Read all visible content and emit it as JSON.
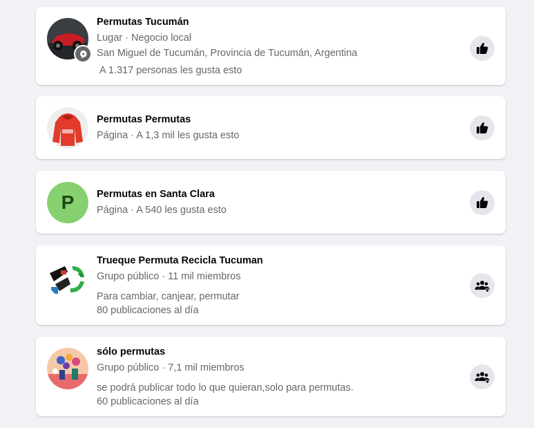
{
  "results": [
    {
      "title": "Permutas Tucumán",
      "meta": "Lugar · Negocio local",
      "location": "San Miguel de Tucumán, Provincia de Tucumán, Argentina",
      "likes": "A 1.317 personas les gusta esto",
      "action_icon": "like-icon"
    },
    {
      "title": "Permutas Permutas",
      "meta": "Página · A 1,3 mil les gusta esto",
      "action_icon": "like-icon"
    },
    {
      "title": "Permutas en Santa Clara",
      "meta": "Página · A 540 les gusta esto",
      "avatar_letter": "P",
      "avatar_color": "#86d06f",
      "action_icon": "like-icon"
    },
    {
      "title": "Trueque Permuta Recicla Tucuman",
      "meta": "Grupo público · 11 mil miembros",
      "description": "Para cambiar, canjear, permutar",
      "activity": "80 publicaciones al día",
      "action_icon": "join-group-icon"
    },
    {
      "title": "sólo permutas",
      "meta": "Grupo público · 7,1 mil miembros",
      "description": "se podrá publicar todo lo que quieran,solo para permutas.",
      "activity": "60 publicaciones al día",
      "action_icon": "join-group-icon"
    }
  ]
}
